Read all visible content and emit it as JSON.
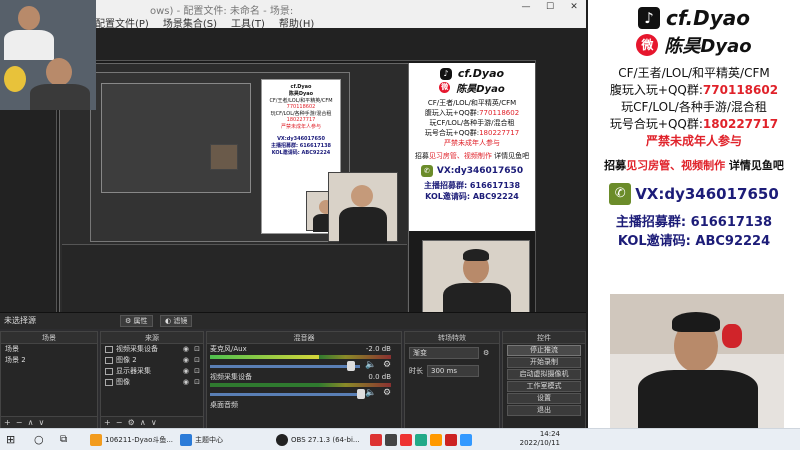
{
  "obs": {
    "title_fragment": "ows) - 配置文件: 未命名 - 场景:",
    "menu": [
      "配置文件(P)",
      "场景集合(S)",
      "工具(T)",
      "帮助(H)"
    ],
    "status_label": "未选择源",
    "status_buttons": [
      "属性",
      "滤镜"
    ],
    "scenes": {
      "title": "场景",
      "items": [
        "场景",
        "场景 2"
      ]
    },
    "sources": {
      "title": "来源",
      "items": [
        "视频采集设备",
        "图像 2",
        "显示器采集",
        "图像"
      ]
    },
    "mixer": {
      "title": "混音器",
      "channels": [
        {
          "name": "麦克风/Aux",
          "db": "-2.0 dB",
          "level": 0.6
        },
        {
          "name": "视频采集设备",
          "db": "0.0 dB",
          "level": 0.0
        },
        {
          "name": "桌面音频",
          "db": "",
          "level": 0.0
        }
      ]
    },
    "transitions": {
      "title": "转场特效",
      "selected": "渐变",
      "duration_label": "时长",
      "duration_value": "300 ms"
    },
    "controls": {
      "title": "控件",
      "buttons": [
        "停止推流",
        "开始录制",
        "启动虚拟摄像机",
        "工作室模式",
        "设置",
        "退出"
      ]
    }
  },
  "promo": {
    "tiktok_name": "cf.Dyao",
    "weibo_name": "陈昊Dyao",
    "line1": "CF/王者/LOL/和平精英/CFM",
    "line2_prefix": "腹玩入玩+QQ群:",
    "line2_value": "770118602",
    "line3": "玩CF/LOL/各种手游/混合租",
    "line4_prefix": "玩号合玩+QQ群:",
    "line4_value": "180227717",
    "warning": "严禁未成年人参与",
    "recruit_parts": [
      "招募",
      "见习房管、视频制作",
      "详情见鱼吧"
    ],
    "wechat_label": "VX:dy346017650",
    "anchor_recruit": "主播招募群: 616617138",
    "kol_code": "KOL邀请码: ABC92224"
  },
  "taskbar": {
    "items": [
      "106211-Dyao斗鱼...",
      "主题中心",
      "OBS 27.1.3 (64-bi..."
    ],
    "time": "14:24",
    "date": "2022/10/11"
  },
  "colors": {
    "red": "#e0222a",
    "tiktok": "#111111",
    "weibo": "#e6162d",
    "wechat": "#6b8c2a"
  }
}
